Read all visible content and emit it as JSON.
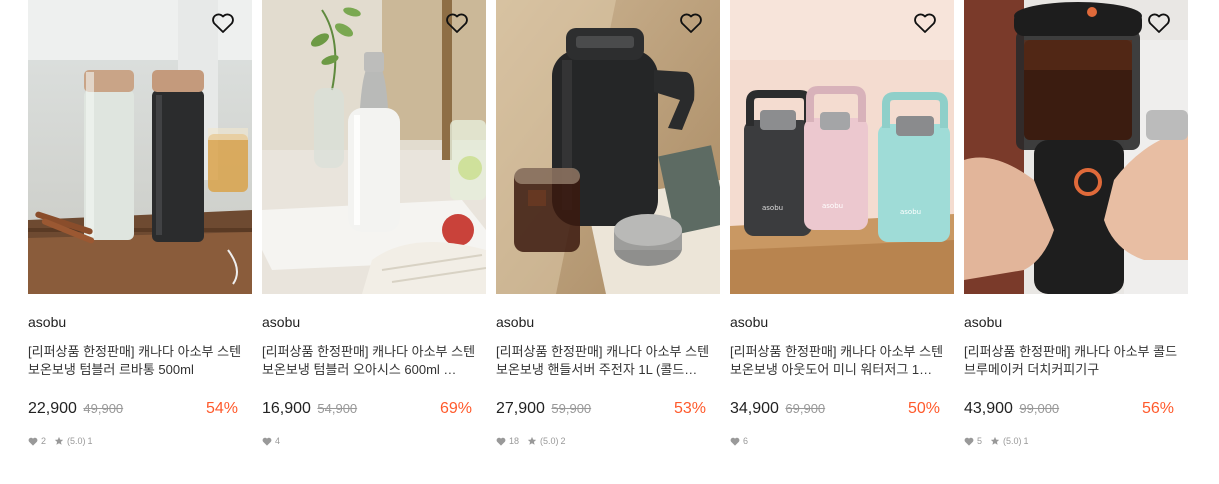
{
  "products": [
    {
      "brand": "asobu",
      "title": "[리퍼상품 한정판매] 캐나다 아소부 스텐 보온보냉 텀블러 르바통 500ml",
      "price": "22,900",
      "original_price": "49,900",
      "discount": "54%",
      "likes": "2",
      "rating": "(5.0)",
      "reviews": "1"
    },
    {
      "brand": "asobu",
      "title": "[리퍼상품 한정판매] 캐나다 아소부 스텐 보온보냉 텀블러 오아시스 600ml …",
      "price": "16,900",
      "original_price": "54,900",
      "discount": "69%",
      "likes": "4"
    },
    {
      "brand": "asobu",
      "title": "[리퍼상품 한정판매] 캐나다 아소부 스텐 보온보냉 핸들서버 주전자 1L (콜드…",
      "price": "27,900",
      "original_price": "59,900",
      "discount": "53%",
      "likes": "18",
      "rating": "(5.0)",
      "reviews": "2"
    },
    {
      "brand": "asobu",
      "title": "[리퍼상품 한정판매] 캐나다 아소부 스텐 보온보냉 아웃도어 미니 워터저그 1…",
      "price": "34,900",
      "original_price": "69,900",
      "discount": "50%",
      "likes": "6"
    },
    {
      "brand": "asobu",
      "title": "[리퍼상품 한정판매] 캐나다 아소부 콜드브루메이커 더치커피기구",
      "price": "43,900",
      "original_price": "99,000",
      "discount": "56%",
      "likes": "5",
      "rating": "(5.0)",
      "reviews": "1"
    }
  ],
  "icons": {
    "wishlist": "heart-outline-icon",
    "likes": "heart-filled-icon",
    "rating": "star-icon"
  },
  "colors": {
    "discount": "#ff5a2c",
    "muted": "#999999"
  }
}
